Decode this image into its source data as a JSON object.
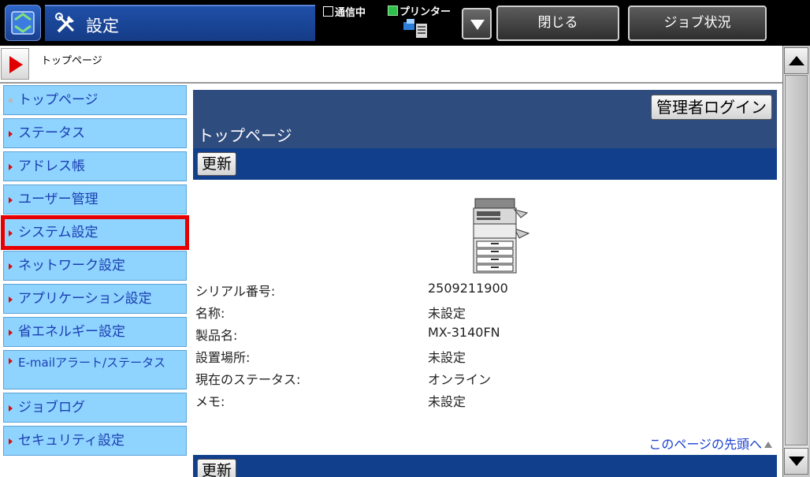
{
  "header": {
    "title": "設定",
    "status_comm": "通信中",
    "status_printer": "プリンター",
    "close_label": "閉じる",
    "job_status_label": "ジョブ状況"
  },
  "breadcrumb": "トップページ",
  "sidebar": {
    "items": [
      {
        "label": "トップページ"
      },
      {
        "label": "ステータス"
      },
      {
        "label": "アドレス帳"
      },
      {
        "label": "ユーザー管理"
      },
      {
        "label": "システム設定"
      },
      {
        "label": "ネットワーク設定"
      },
      {
        "label": "アプリケーション設定"
      },
      {
        "label": "省エネルギー設定"
      },
      {
        "label": "E-mailアラート/ステータス"
      },
      {
        "label": "ジョブログ"
      },
      {
        "label": "セキュリティ設定"
      }
    ]
  },
  "main": {
    "admin_login": "管理者ログイン",
    "page_title": "トップページ",
    "update_label": "更新",
    "update_label_bottom": "更新",
    "info": [
      {
        "label": "シリアル番号:",
        "value": "2509211900"
      },
      {
        "label": "名称:",
        "value": "未設定"
      },
      {
        "label": "製品名:",
        "value": "MX-3140FN"
      },
      {
        "label": "設置場所:",
        "value": "未設定"
      },
      {
        "label": "現在のステータス:",
        "value": "オンライン"
      },
      {
        "label": "メモ:",
        "value": "未設定"
      }
    ],
    "page_top_link": "このページの先頭へ"
  },
  "colors": {
    "sidebar_bg": "#8fd3ff",
    "header_bg": "#2f4c7e",
    "bar_bg": "#113f8c",
    "selected_outline": "#e60000"
  }
}
